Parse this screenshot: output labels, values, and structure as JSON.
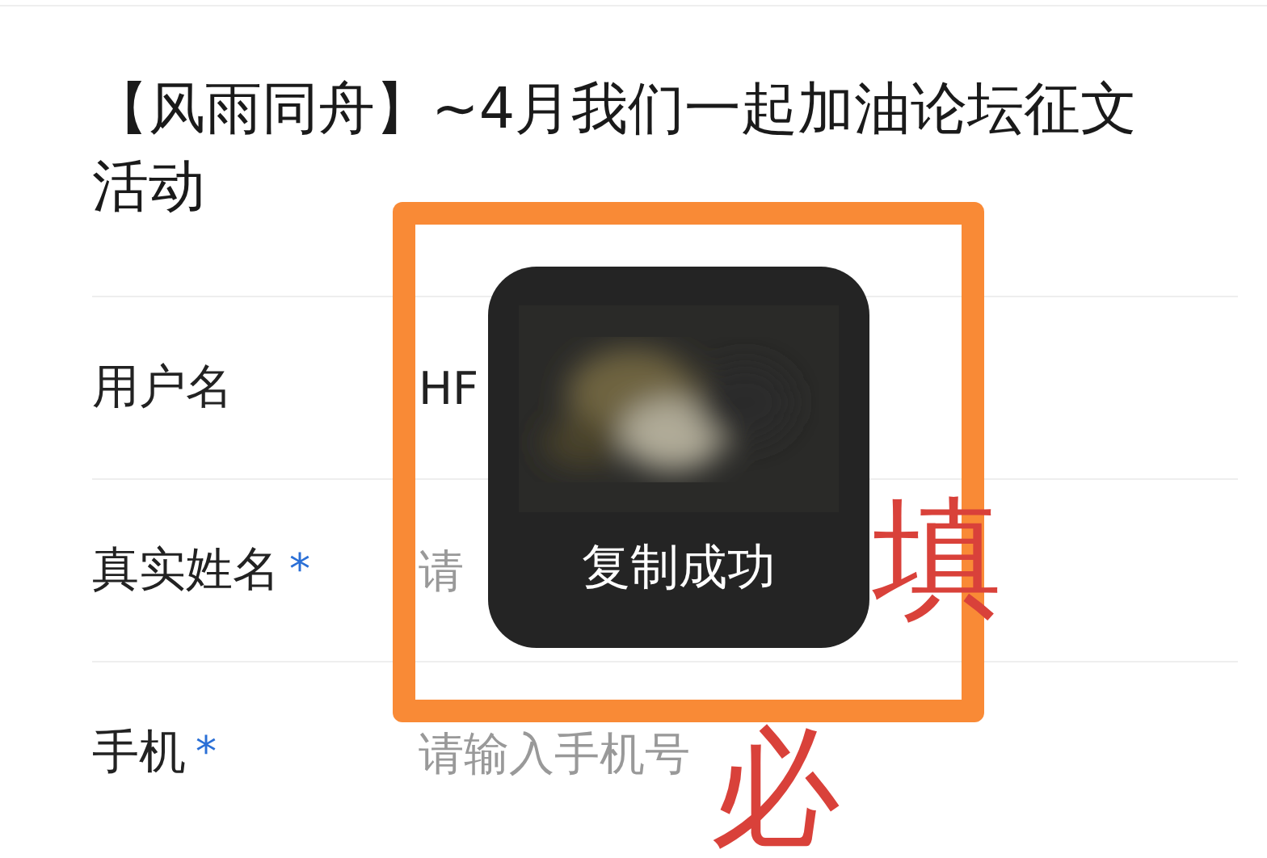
{
  "title": "【风雨同舟】~4月我们一起加油论坛征文活动",
  "fields": [
    {
      "label": "用户名",
      "value": "HF"
    },
    {
      "label": "真实姓名",
      "marker": "*",
      "placeholder": "请"
    },
    {
      "label": "手机",
      "marker": "*",
      "placeholder": "请输入手机号"
    }
  ],
  "toast": {
    "message": "复制成功",
    "kind": "picture"
  },
  "annotations": [
    {
      "text": "填",
      "kind": "note"
    },
    {
      "text": "必",
      "kind": "note"
    }
  ]
}
